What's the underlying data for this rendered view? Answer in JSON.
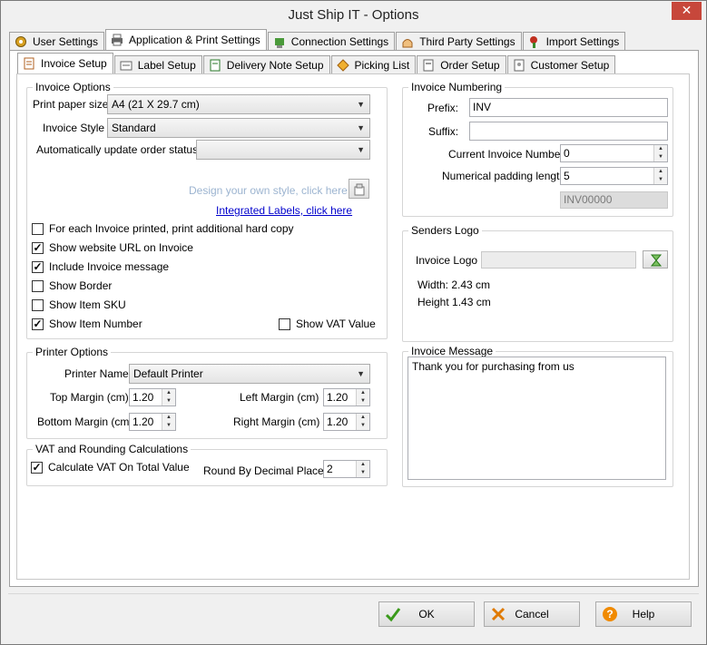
{
  "window": {
    "title": "Just Ship IT - Options",
    "close": "✕"
  },
  "main_tabs": [
    {
      "label": "User Settings",
      "icon": "gear-icon"
    },
    {
      "label": "Application & Print Settings",
      "icon": "printer-icon"
    },
    {
      "label": "Connection Settings",
      "icon": "plug-icon"
    },
    {
      "label": "Third Party Settings",
      "icon": "hand-icon"
    },
    {
      "label": "Import Settings",
      "icon": "import-icon"
    }
  ],
  "sub_tabs": [
    {
      "label": "Invoice Setup"
    },
    {
      "label": "Label Setup"
    },
    {
      "label": "Delivery Note Setup"
    },
    {
      "label": "Picking List"
    },
    {
      "label": "Order Setup"
    },
    {
      "label": "Customer Setup"
    }
  ],
  "invoice_options": {
    "legend": "Invoice Options",
    "paper_size_label": "Print paper size",
    "paper_size_value": "A4 (21 X 29.7 cm)",
    "style_label": "Invoice Style",
    "style_value": "Standard",
    "auto_update_label": "Automatically update order status:",
    "auto_update_value": "",
    "design_hint": "Design your own style, click here >",
    "integrated_link": "Integrated Labels, click here",
    "checks": [
      {
        "label": "For each Invoice printed, print additional hard copy",
        "checked": false
      },
      {
        "label": "Show website URL on Invoice",
        "checked": true
      },
      {
        "label": "Include Invoice message",
        "checked": true
      },
      {
        "label": "Show Border",
        "checked": false
      },
      {
        "label": "Show Item SKU",
        "checked": false
      },
      {
        "label": "Show Item Number",
        "checked": true
      }
    ],
    "vat_value_check": {
      "label": "Show VAT Value",
      "checked": false
    }
  },
  "printer_options": {
    "legend": "Printer Options",
    "printer_label": "Printer Name",
    "printer_value": "Default Printer",
    "top_label": "Top Margin (cm)",
    "top_value": "1.20",
    "left_label": "Left Margin (cm)",
    "left_value": "1.20",
    "bottom_label": "Bottom Margin (cm)",
    "bottom_value": "1.20",
    "right_label": "Right Margin (cm)",
    "right_value": "1.20"
  },
  "vat": {
    "legend": "VAT and Rounding Calculations",
    "calc_label": "Calculate VAT On Total Value",
    "calc_checked": true,
    "round_label": "Round By Decimal Places:",
    "round_value": "2"
  },
  "numbering": {
    "legend": "Invoice Numbering",
    "prefix_label": "Prefix:",
    "prefix_value": "INV",
    "suffix_label": "Suffix:",
    "suffix_value": "",
    "current_label": "Current Invoice Number",
    "current_value": "0",
    "padding_label": "Numerical padding length",
    "padding_value": "5",
    "preview_value": "INV00000"
  },
  "logo": {
    "legend": "Senders Logo",
    "logo_label": "Invoice Logo",
    "logo_value": "",
    "width_text": "Width: 2.43 cm",
    "height_text": "Height 1.43 cm"
  },
  "message": {
    "legend": "Invoice Message",
    "text": "Thank you for purchasing from us"
  },
  "footer": {
    "ok": "OK",
    "cancel": "Cancel",
    "help": "Help"
  },
  "colors": {
    "check_green": "#3a9a1a",
    "cancel_orange": "#e07a00",
    "help_orange": "#f08a00",
    "close_red": "#c7473b"
  }
}
